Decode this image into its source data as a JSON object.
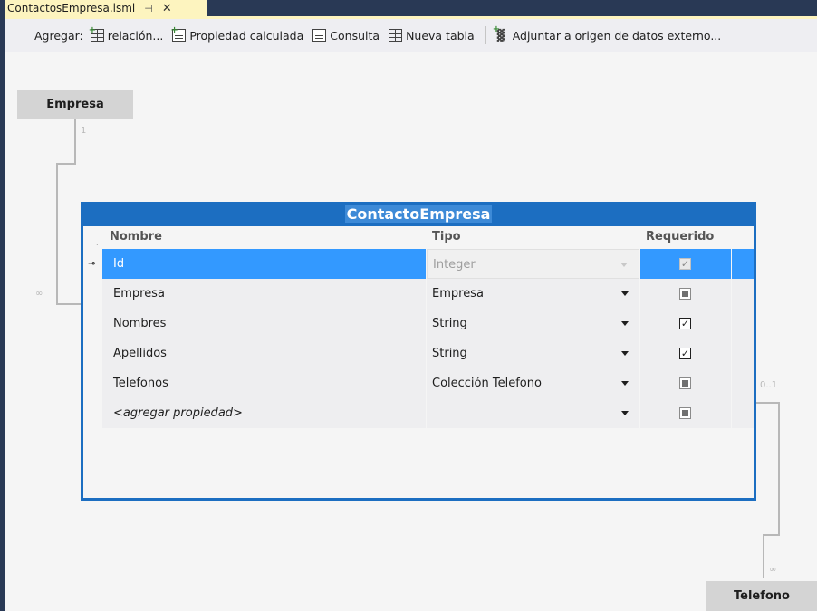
{
  "tab": {
    "title": "ContactosEmpresa.lsml",
    "pin": "⊣",
    "close": "✕"
  },
  "toolbar": {
    "add_label": "Agregar:",
    "buttons": [
      {
        "label": "relación...",
        "icon": "add-relation-icon"
      },
      {
        "label": "Propiedad calculada",
        "icon": "computed-property-icon"
      },
      {
        "label": "Consulta",
        "icon": "query-icon"
      },
      {
        "label": "Nueva tabla",
        "icon": "new-table-icon"
      },
      {
        "label": "Adjuntar a origen de datos externo...",
        "icon": "attach-datasource-icon"
      }
    ]
  },
  "related_entities": {
    "empresa": {
      "name": "Empresa",
      "mult_top": "1",
      "mult_bottom": "∞"
    },
    "telefono": {
      "name": "Telefono",
      "mult_top": "0..1",
      "mult_bottom": "∞"
    }
  },
  "entity": {
    "title": "ContactoEmpresa",
    "columns": {
      "name": "Nombre",
      "type": "Tipo",
      "required": "Requerido"
    },
    "rows": [
      {
        "name": "Id",
        "type": "Integer",
        "required": "checked",
        "key": true,
        "selected": true
      },
      {
        "name": "Empresa",
        "type": "Empresa",
        "required": "indeterminate"
      },
      {
        "name": "Nombres",
        "type": "String",
        "required": "checked"
      },
      {
        "name": "Apellidos",
        "type": "String",
        "required": "checked"
      },
      {
        "name": "Telefonos",
        "type": "Colección Telefono",
        "required": "indeterminate"
      },
      {
        "name": "<agregar propiedad>",
        "type": "",
        "required": "indeterminate",
        "placeholder": true
      }
    ]
  },
  "colors": {
    "accent": "#1c6ec1",
    "selection": "#3399ff",
    "tab_active": "#fdf4bf",
    "frame": "#293955"
  }
}
